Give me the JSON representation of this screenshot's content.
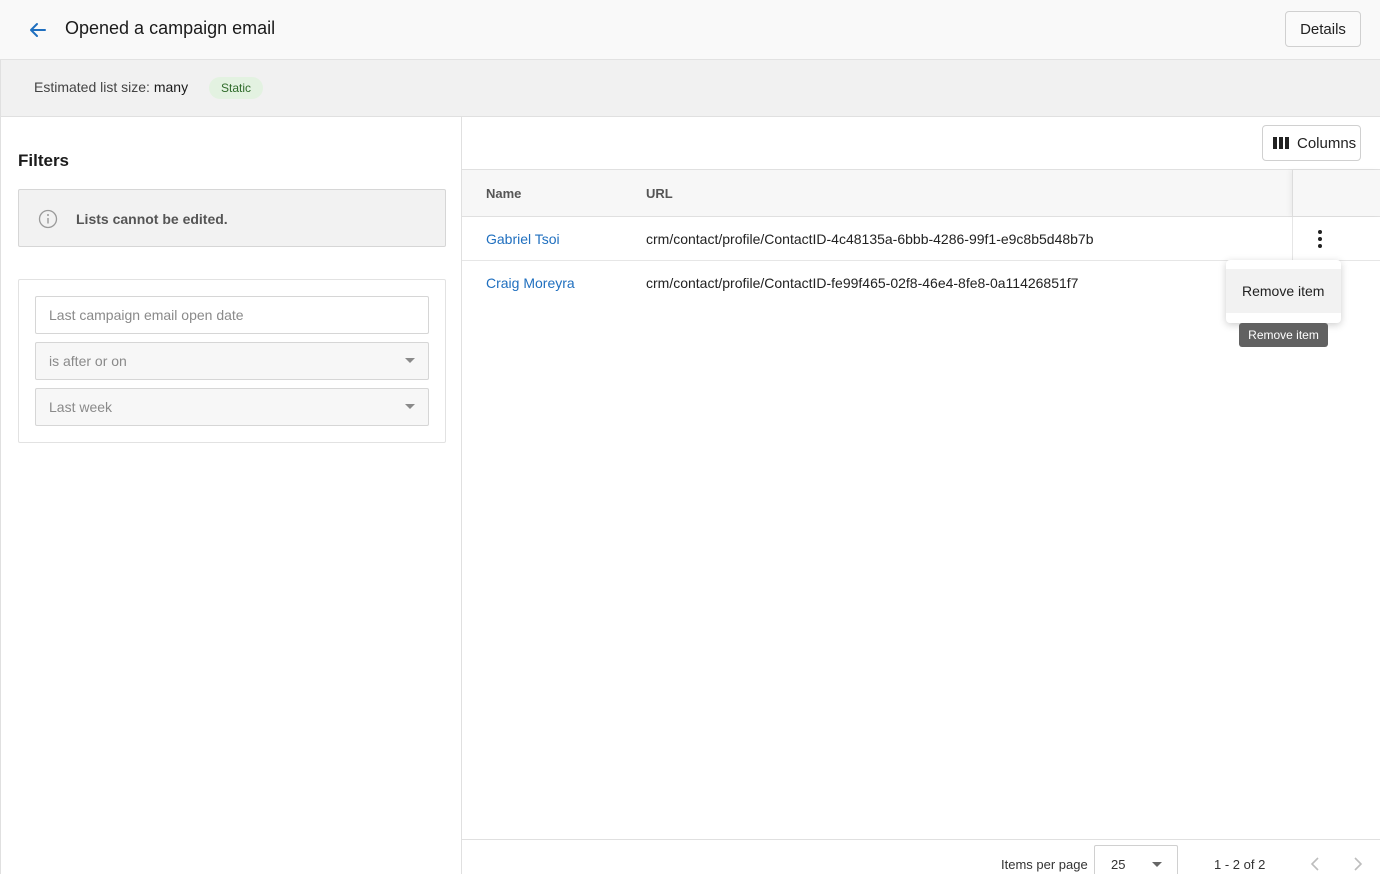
{
  "header": {
    "back_icon": "arrow-left-icon",
    "title": "Opened a campaign email",
    "details_label": "Details"
  },
  "info": {
    "size_label": "Estimated list size:",
    "size_value": "many",
    "badge": "Static"
  },
  "filters": {
    "title": "Filters",
    "notice_icon": "info-icon",
    "notice": "Lists cannot be edited.",
    "field": {
      "placeholder": "Last campaign email open date"
    },
    "operator": {
      "value": "is after or on"
    },
    "value": {
      "value": "Last week"
    }
  },
  "table": {
    "columns_button": "Columns",
    "columns_icon": "columns-icon",
    "headers": {
      "name": "Name",
      "url": "URL"
    },
    "rows": [
      {
        "name": "Gabriel Tsoi",
        "url": "crm/contact/profile/ContactID-4c48135a-6bbb-4286-99f1-e9c8b5d48b7b"
      },
      {
        "name": "Craig Moreyra",
        "url": "crm/contact/profile/ContactID-fe99f465-02f8-46e4-8fe8-0a11426851f7"
      }
    ]
  },
  "row_menu": {
    "icon": "more-vertical-icon",
    "item": "Remove item",
    "tooltip": "Remove item"
  },
  "pagination": {
    "items_per_page_label": "Items per page",
    "items_per_page": "25",
    "range": "1 - 2 of 2"
  },
  "colors": {
    "link": "#1f6fbf",
    "back_arrow": "#1f6fbf",
    "badge_bg": "#e3f2e1",
    "badge_text": "#2f6b2a",
    "tooltip_bg": "#616161"
  }
}
